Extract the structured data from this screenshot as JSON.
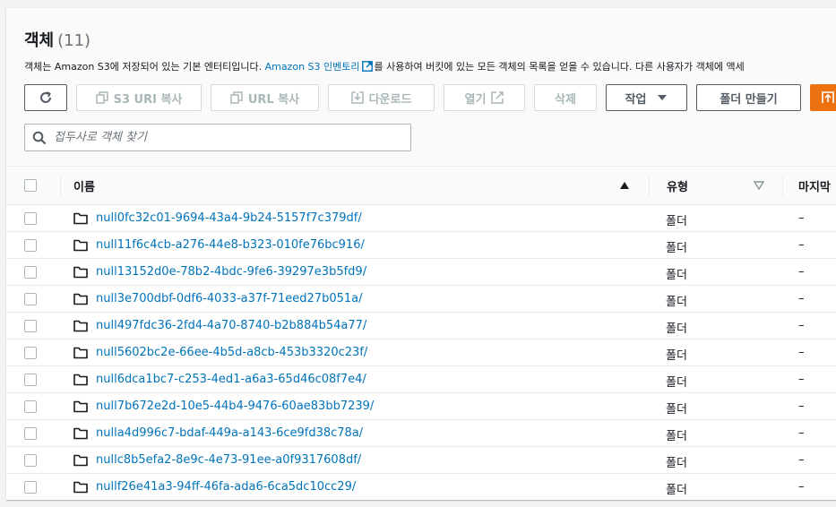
{
  "header": {
    "title": "객체",
    "count": "(11)",
    "desc_prefix": "객체는 Amazon S3에 저장되어 있는 기본 엔터티입니다. ",
    "desc_link": "Amazon S3 인벤토리",
    "desc_suffix": "를 사용하여 버킷에 있는 모든 객체의 목록을 얻을 수 있습니다. 다른 사용자가 객체에 액세"
  },
  "toolbar": {
    "refresh_label": "",
    "copy_s3_uri": "S3 URI 복사",
    "copy_url": "URL 복사",
    "download": "다운로드",
    "open": "열기",
    "delete": "삭제",
    "actions": "작업",
    "create_folder": "폴더 만들기"
  },
  "search": {
    "placeholder": "접두사로 객체 찾기"
  },
  "table": {
    "columns": {
      "name": "이름",
      "type": "유형",
      "modified": "마지막"
    },
    "rows": [
      {
        "name": "null0fc32c01-9694-43a4-9b24-5157f7c379df/",
        "type": "폴더",
        "modified": "–"
      },
      {
        "name": "null11f6c4cb-a276-44e8-b323-010fe76bc916/",
        "type": "폴더",
        "modified": "–"
      },
      {
        "name": "null13152d0e-78b2-4bdc-9fe6-39297e3b5fd9/",
        "type": "폴더",
        "modified": "–"
      },
      {
        "name": "null3e700dbf-0df6-4033-a37f-71eed27b051a/",
        "type": "폴더",
        "modified": "–"
      },
      {
        "name": "null497fdc36-2fd4-4a70-8740-b2b884b54a77/",
        "type": "폴더",
        "modified": "–"
      },
      {
        "name": "null5602bc2e-66ee-4b5d-a8cb-453b3320c23f/",
        "type": "폴더",
        "modified": "–"
      },
      {
        "name": "null6dca1bc7-c253-4ed1-a6a3-65d46c08f7e4/",
        "type": "폴더",
        "modified": "–"
      },
      {
        "name": "null7b672e2d-10e5-44b4-9476-60ae83bb7239/",
        "type": "폴더",
        "modified": "–"
      },
      {
        "name": "nulla4d996c7-bdaf-449a-a143-6ce9fd38c78a/",
        "type": "폴더",
        "modified": "–"
      },
      {
        "name": "nullc8b5efa2-8e9c-4e73-91ee-a0f9317608df/",
        "type": "폴더",
        "modified": "–"
      },
      {
        "name": "nullf26e41a3-94ff-46fa-ada6-6ca5dc10cc29/",
        "type": "폴더",
        "modified": "–"
      }
    ]
  },
  "colors": {
    "link": "#0073bb",
    "primary": "#ec7211",
    "border": "#d5dbdb"
  }
}
